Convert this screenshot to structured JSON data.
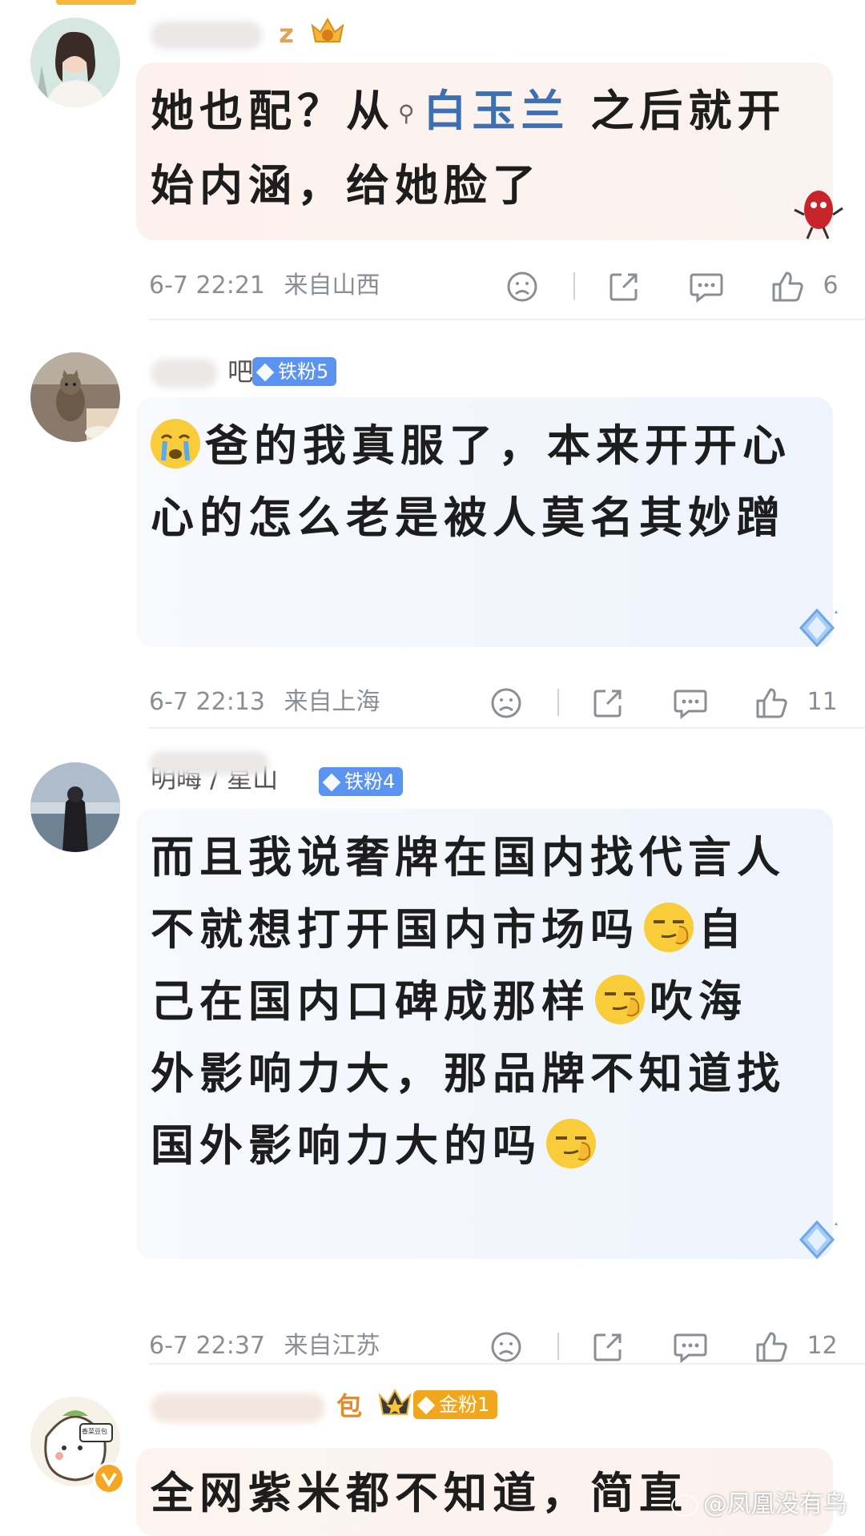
{
  "comments": [
    {
      "username_suffix": "z",
      "badge": "",
      "text_before": "她也配？从",
      "link": "白玉兰",
      "text_after": " 之后就开始内涵，给她脸了",
      "time": "6-7 22:21",
      "location": "来自山西",
      "likes": "6"
    },
    {
      "username_suffix": "吧",
      "badge": "铁粉5",
      "text": "爸的我真服了，本来开开心心的怎么老是被人莫名其妙蹭",
      "time": "6-7 22:13",
      "location": "来自上海",
      "likes": "11"
    },
    {
      "username": "明晦 / 星山",
      "badge": "铁粉4",
      "text_parts": [
        "而且我说奢牌在国内找代言人不就想打开国内市场吗",
        "自己在国内口碑成那样",
        "吹海外影响力大，那品牌不知道找国外影响力大的吗"
      ],
      "time": "6-7 22:37",
      "location": "来自江苏",
      "likes": "12"
    },
    {
      "username_suffix": "包",
      "badge": "金粉1",
      "text": "全网紫米都不知道，简直",
      "avatar_label": "香菜豆包"
    }
  ],
  "watermark": "@凤凰没有鸟",
  "icons": [
    "dislike-icon",
    "share-icon",
    "comment-icon",
    "like-icon"
  ],
  "colors": {
    "badge_iron": "#5b93f0",
    "badge_gold": "#f0a61d",
    "link": "#3d6fb3",
    "bubble_pink": "#fdf1ee",
    "bubble_blue": "#eef4fd"
  }
}
